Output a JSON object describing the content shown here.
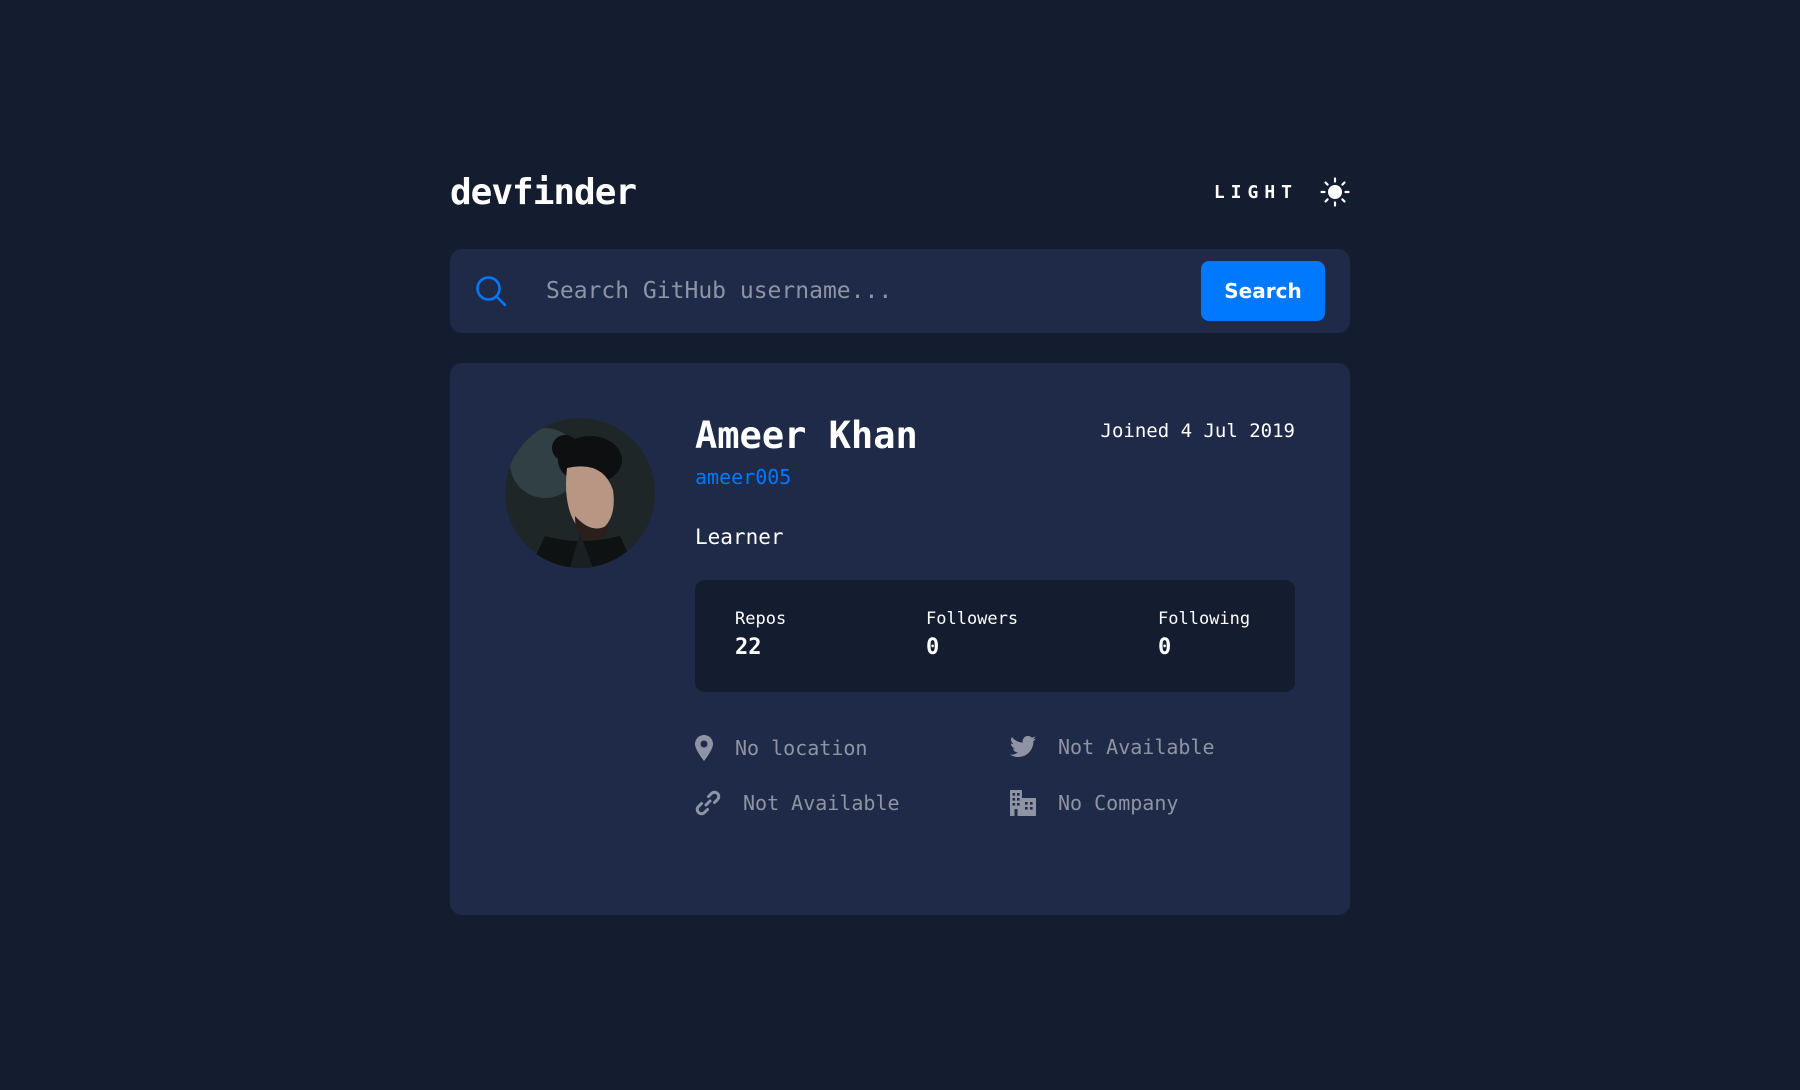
{
  "header": {
    "logo": "devfinder",
    "theme_label": "LIGHT",
    "theme_icon": "sun-icon"
  },
  "search": {
    "placeholder": "Search GitHub username...",
    "value": "",
    "button_label": "Search",
    "icon": "search-icon"
  },
  "profile": {
    "name": "Ameer Khan",
    "login": "ameer005",
    "joined": "Joined 4 Jul 2019",
    "bio": "Learner",
    "stats": {
      "repos_label": "Repos",
      "repos": "22",
      "followers_label": "Followers",
      "followers": "0",
      "following_label": "Following",
      "following": "0"
    },
    "links": {
      "location": "No location",
      "twitter": "Not Available",
      "blog": "Not Available",
      "company": "No Company"
    }
  },
  "colors": {
    "background": "#141c2f",
    "card": "#1e2a47",
    "accent": "#0079ff",
    "muted": "#8e94a4"
  }
}
